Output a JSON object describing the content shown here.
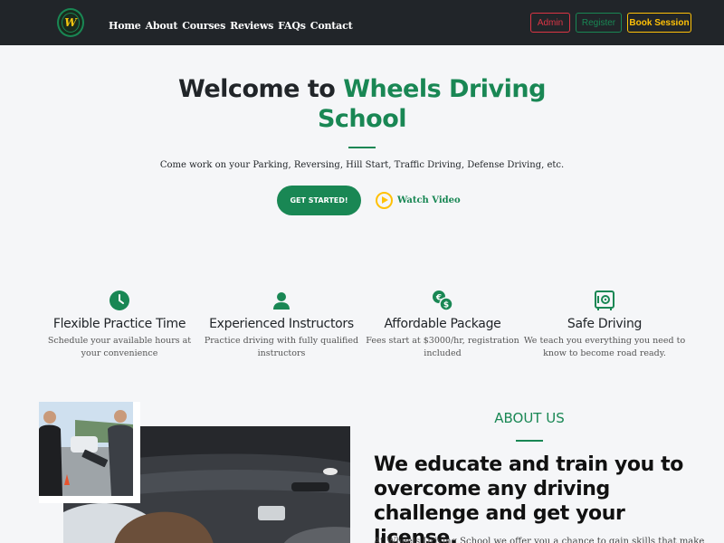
{
  "nav": {
    "logo_letter": "W",
    "links": [
      "Home",
      "About",
      "Courses",
      "Reviews",
      "FAQs",
      "Contact"
    ],
    "admin_label": "Admin",
    "register_label": "Register",
    "book_label": "Book Session"
  },
  "hero": {
    "title_prefix": "Welcome to ",
    "title_accent": "Wheels Driving School",
    "subtitle": "Come work on your Parking, Reversing, Hill Start, Traffic Driving, Defense Driving, etc.",
    "cta_label": "GET STARTED!",
    "watch_label": "Watch Video"
  },
  "features": [
    {
      "icon": "clock-icon",
      "title": "Flexible Practice Time",
      "desc": "Schedule your available hours at your convenience"
    },
    {
      "icon": "user-icon",
      "title": "Experienced Instructors",
      "desc": "Practice driving with fully qualified instructors"
    },
    {
      "icon": "money-icon",
      "title": "Affordable Package",
      "desc": "Fees start at $3000/hr, registration included"
    },
    {
      "icon": "safe-icon",
      "title": "Safe Driving",
      "desc": "We teach you everything you need to know to become road ready."
    }
  ],
  "about": {
    "label": "ABOUT US",
    "heading": "We educate and train you to overcome any driving challenge and get your license.",
    "text": "At Wheels Driving School we offer you a chance to gain skills that make"
  },
  "colors": {
    "navbar": "#212529",
    "primary_green": "#198754",
    "danger": "#dc3545",
    "warning": "#ffc107",
    "background": "#f5f6f8"
  }
}
